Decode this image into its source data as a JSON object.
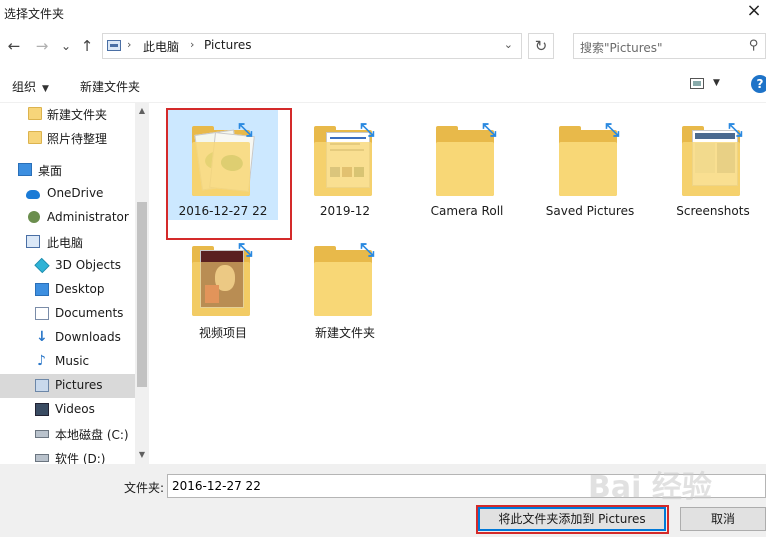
{
  "window": {
    "title": "选择文件夹",
    "close_glyph": "×"
  },
  "address": {
    "back": "←",
    "forward": "→",
    "recent": "⌄",
    "up": "↑",
    "crumbs": [
      "此电脑",
      "Pictures"
    ],
    "separator": "›",
    "dropdown": "⌄",
    "refresh": "↻"
  },
  "search": {
    "placeholder": "搜索\"Pictures\"",
    "icon": "search-icon"
  },
  "toolbar": {
    "organize": "组织",
    "new_folder": "新建文件夹",
    "help": "?"
  },
  "sidebar": {
    "items": [
      {
        "label": "新建文件夹",
        "icon": "folder-icon"
      },
      {
        "label": "照片待整理",
        "icon": "folder-icon"
      },
      {
        "label": "桌面",
        "icon": "desktop-icon"
      },
      {
        "label": "OneDrive",
        "icon": "onedrive-icon"
      },
      {
        "label": "Administrator",
        "icon": "user-icon"
      },
      {
        "label": "此电脑",
        "icon": "this-pc-icon"
      },
      {
        "label": "3D Objects",
        "icon": "3d-objects-icon"
      },
      {
        "label": "Desktop",
        "icon": "desktop-icon"
      },
      {
        "label": "Documents",
        "icon": "documents-icon"
      },
      {
        "label": "Downloads",
        "icon": "downloads-icon"
      },
      {
        "label": "Music",
        "icon": "music-icon"
      },
      {
        "label": "Pictures",
        "icon": "pictures-icon"
      },
      {
        "label": "Videos",
        "icon": "videos-icon"
      },
      {
        "label": "本地磁盘 (C:)",
        "icon": "drive-icon"
      },
      {
        "label": "软件 (D:)",
        "icon": "drive-icon"
      }
    ],
    "selected": "Pictures"
  },
  "content": {
    "folders": [
      {
        "label": "2016-12-27 22",
        "selected": true
      },
      {
        "label": "2019-12",
        "selected": false
      },
      {
        "label": "Camera Roll",
        "selected": false
      },
      {
        "label": "Saved Pictures",
        "selected": false
      },
      {
        "label": "Screenshots",
        "selected": false
      },
      {
        "label": "视频项目",
        "selected": false
      },
      {
        "label": "新建文件夹",
        "selected": false
      }
    ]
  },
  "footer": {
    "folder_label": "文件夹:",
    "folder_value": "2016-12-27 22",
    "confirm_button": "将此文件夹添加到 Pictures",
    "cancel_button": "取消"
  },
  "watermark": "Bai 经验",
  "colors": {
    "accent": "#0078d7",
    "selection": "#cce8ff",
    "highlight_red": "#d42a2a",
    "folder": "#f8d776"
  }
}
